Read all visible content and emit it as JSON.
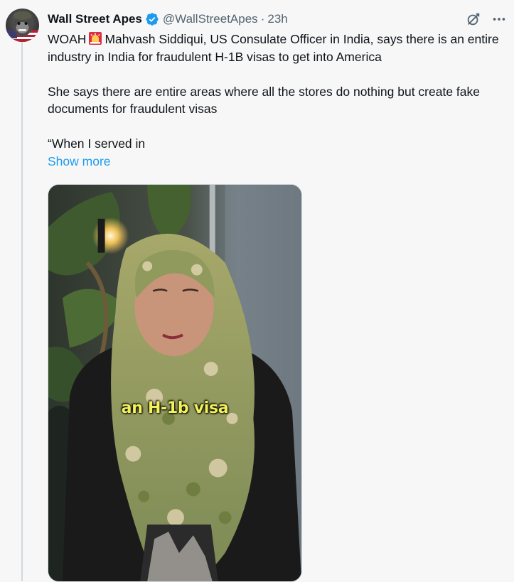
{
  "author": {
    "display_name": "Wall Street Apes",
    "handle": "@WallStreetApes",
    "separator": "·",
    "timestamp": "23h",
    "verified": true
  },
  "icons": {
    "avatar": "gorilla-avatar",
    "verified": "verified-badge-icon",
    "grok": "grok-icon",
    "more": "more-icon",
    "siren": "siren-emoji-icon"
  },
  "tweet": {
    "line1_before": "WOAH",
    "line1_after": "Mahvash Siddiqui, US Consulate Officer in India, says there is an entire industry in India for fraudulent H-1B visas to get into America",
    "para2": "She says there are entire areas where all the stores do nothing but create fake documents for fraudulent visas",
    "para3": "“When I served in",
    "show_more": "Show more"
  },
  "media": {
    "caption": "an H-1b visa"
  },
  "colors": {
    "link": "#1d9bf0",
    "secondary_text": "#536471",
    "caption": "#f2f25a"
  }
}
